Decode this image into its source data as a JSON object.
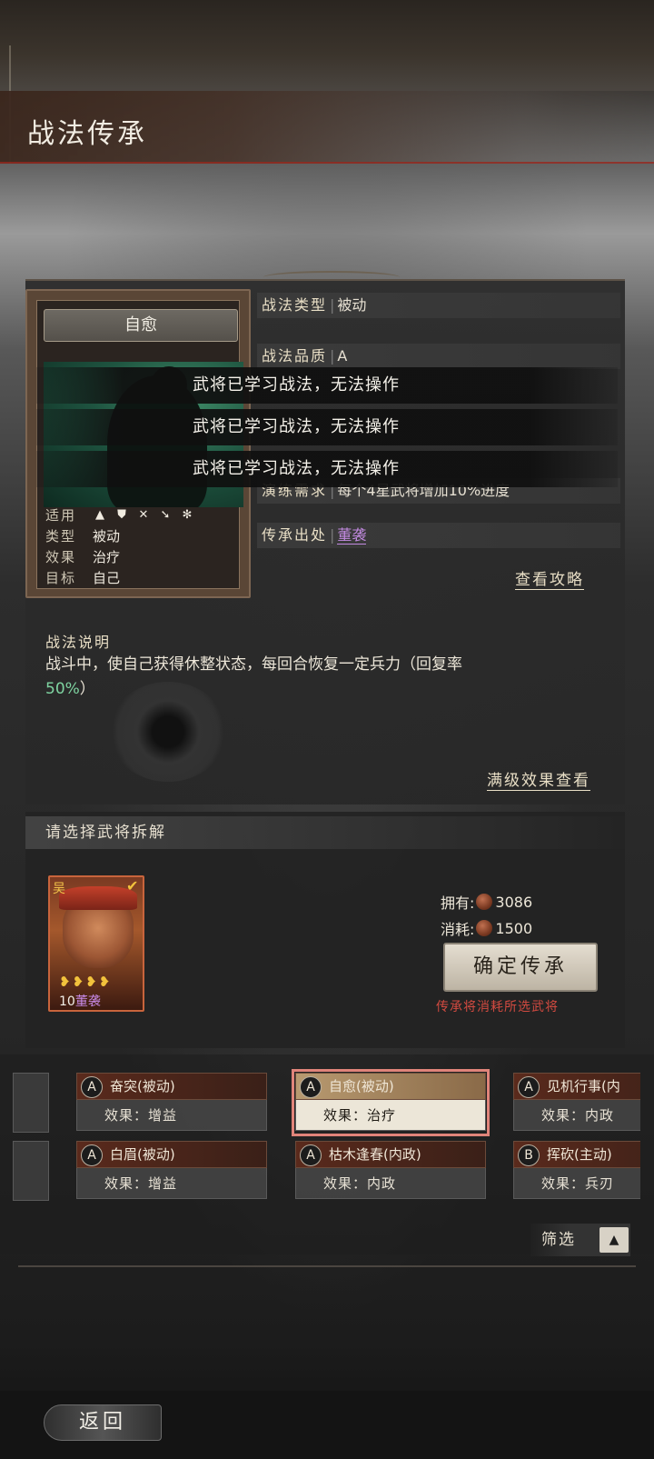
{
  "page": {
    "title": "战法传承",
    "back_label": "返回"
  },
  "skill_card": {
    "name": "自愈",
    "applicable_label": "适用",
    "weapons": [
      "cavalry-icon",
      "shield-icon",
      "bow-icon",
      "spear-icon",
      "chariot-icon"
    ],
    "type_label": "类型",
    "type_value": "被动",
    "effect_label": "效果",
    "effect_value": "治疗",
    "target_label": "目标",
    "target_value": "自己"
  },
  "info": {
    "type_label": "战法类型",
    "type_value": "被动",
    "quality_label": "战法品质",
    "quality_value": "A",
    "drill_label": "演练需求",
    "drill_value": "每个4星武将增加10%进度",
    "source_label": "传承出处",
    "source_value": "董袭",
    "guide_link": "查看攻略"
  },
  "toasts": [
    "武将已学习战法，无法操作",
    "武将已学习战法，无法操作",
    "武将已学习战法，无法操作"
  ],
  "description": {
    "title": "战法说明",
    "text": "战斗中，使自己获得休整状态，每回合恢复一定兵力（回复率",
    "highlight": "50%",
    "text_end": "）",
    "max_level_link": "满级效果查看"
  },
  "selection": {
    "header": "请选择武将拆解",
    "hero": {
      "faction": "吴",
      "level": "10",
      "name": "董袭",
      "stars": "❥❥❥❥"
    },
    "own_label": "拥有:",
    "own_value": "3086",
    "cost_label": "消耗:",
    "cost_value": "1500",
    "confirm_label": "确定传承",
    "confirm_note": "传承将消耗所选武将"
  },
  "skill_list": [
    {
      "grade": "A",
      "name": "奋突(被动)",
      "effect": "效果：增益"
    },
    {
      "grade": "A",
      "name": "自愈(被动)",
      "effect": "效果：治疗"
    },
    {
      "grade": "A",
      "name": "见机行事(内",
      "effect": "效果：内政"
    },
    {
      "grade": "A",
      "name": "白眉(被动)",
      "effect": "效果：增益"
    },
    {
      "grade": "A",
      "name": "枯木逢春(内政)",
      "effect": "效果：内政"
    },
    {
      "grade": "B",
      "name": "挥砍(主动)",
      "effect": "效果：兵刃"
    }
  ],
  "filter_label": "筛选",
  "colors": {
    "accent_red": "#d24a40",
    "source_purple": "#c28ae0",
    "highlight_green": "#7ed3a0"
  }
}
